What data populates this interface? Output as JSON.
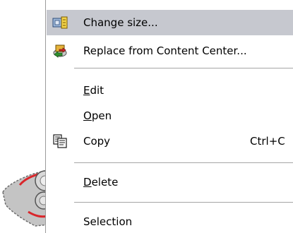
{
  "context_menu": {
    "items": [
      {
        "label": "Change size...",
        "mnemonic_index": -1,
        "icon": "change-size-icon",
        "highlighted": true
      },
      {
        "label": "Replace from Content Center...",
        "mnemonic_index": -1,
        "icon": "replace-content-center-icon",
        "highlighted": false
      },
      {
        "label_pre": "",
        "label_mn": "E",
        "label_post": "dit"
      },
      {
        "label_pre": "",
        "label_mn": "O",
        "label_post": "pen"
      },
      {
        "label": "Copy",
        "shortcut": "Ctrl+C",
        "icon": "copy-icon"
      },
      {
        "label_pre": "",
        "label_mn": "D",
        "label_post": "elete"
      },
      {
        "label": "Selection"
      }
    ]
  },
  "colors": {
    "highlight": "#c6c8cf",
    "separator": "#a6a6a6",
    "part_red": "#d9262b",
    "part_gray": "#b9b9b9"
  }
}
